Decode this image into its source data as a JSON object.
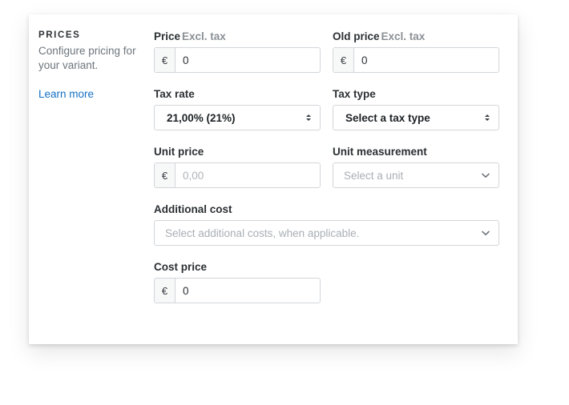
{
  "panel": {
    "heading": "PRICES",
    "description": "Configure pricing for your variant.",
    "learn_more": "Learn more",
    "link_color": "#1570c4"
  },
  "fields": {
    "price": {
      "label": "Price",
      "label_note": "Excl. tax",
      "currency": "€",
      "value": "0"
    },
    "old_price": {
      "label": "Old price",
      "label_note": "Excl. tax",
      "currency": "€",
      "value": "0"
    },
    "tax_rate": {
      "label": "Tax rate",
      "value": "21,00% (21%)"
    },
    "tax_type": {
      "label": "Tax type",
      "value": "Select a tax type"
    },
    "unit_price": {
      "label": "Unit price",
      "currency": "€",
      "placeholder": "0,00",
      "value": ""
    },
    "unit_measurement": {
      "label": "Unit measurement",
      "placeholder": "Select a unit"
    },
    "additional_cost": {
      "label": "Additional cost",
      "placeholder": "Select additional costs, when applicable."
    },
    "cost_price": {
      "label": "Cost price",
      "currency": "€",
      "value": "0"
    }
  }
}
